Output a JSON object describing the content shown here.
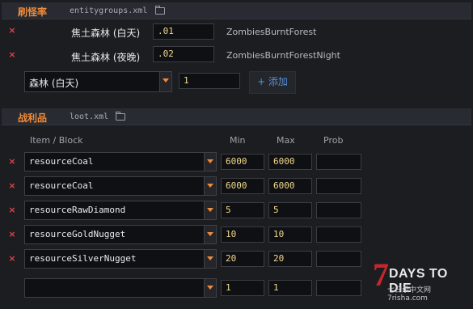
{
  "entity_groups": {
    "title": "刷怪率",
    "file": "entitygroups.xml",
    "rows": [
      {
        "label": "焦土森林 (白天)",
        "value": ".01",
        "group": "ZombiesBurntForest"
      },
      {
        "label": "焦土森林 (夜晚)",
        "value": ".02",
        "group": "ZombiesBurntForestNight"
      }
    ],
    "new_entry": {
      "selected": "森林 (白天)",
      "value": "1",
      "add_label": "+ 添加"
    }
  },
  "loot": {
    "title": "战利品",
    "file": "loot.xml",
    "columns": {
      "item": "Item / Block",
      "min": "Min",
      "max": "Max",
      "prob": "Prob"
    },
    "rows": [
      {
        "item": "resourceCoal",
        "min": "6000",
        "max": "6000",
        "prob": ""
      },
      {
        "item": "resourceCoal",
        "min": "6000",
        "max": "6000",
        "prob": ""
      },
      {
        "item": "resourceRawDiamond",
        "min": "5",
        "max": "5",
        "prob": ""
      },
      {
        "item": "resourceGoldNugget",
        "min": "10",
        "max": "10",
        "prob": ""
      },
      {
        "item": "resourceSilverNugget",
        "min": "20",
        "max": "20",
        "prob": ""
      }
    ],
    "new_entry": {
      "item": "",
      "min": "1",
      "max": "1",
      "prob": ""
    }
  },
  "watermark": {
    "seven": "7",
    "title": "DAYS TO DIE",
    "sub": "七日杀中文网 7risha.com"
  },
  "icons": {
    "delete": "×",
    "folder": "folder-icon",
    "dropdown": "chevron-down-icon"
  },
  "colors": {
    "accent": "#f08a3a",
    "delete": "#e0434b",
    "link": "#5b8fd8",
    "value": "#f2d98c"
  }
}
